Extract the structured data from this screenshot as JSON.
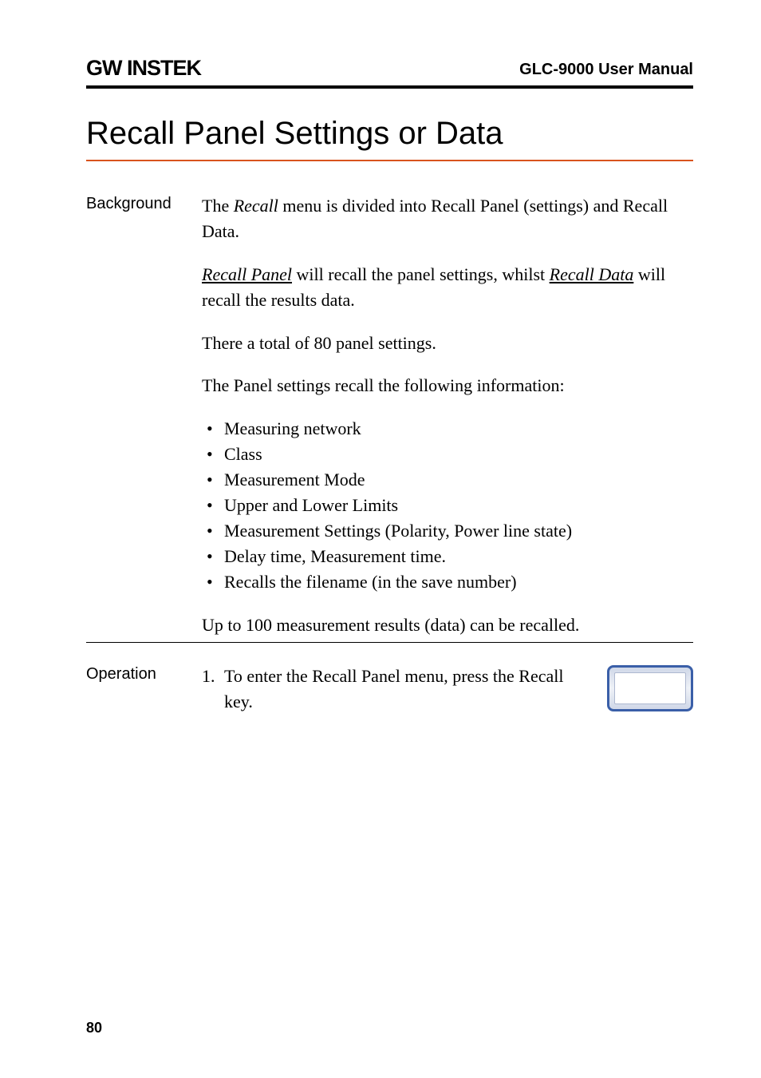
{
  "header": {
    "logo": "GW INSTEK",
    "manual": "GLC-9000 User Manual"
  },
  "section_title": "Recall Panel Settings or Data",
  "background": {
    "label": "Background",
    "p1_prefix": "The ",
    "p1_recall": "Recall",
    "p1_suffix": " menu is divided into Recall Panel (settings) and Recall Data.",
    "p2_recall_panel": "Recall Panel",
    "p2_mid": " will recall the panel settings, whilst ",
    "p2_recall_data": "Recall Data",
    "p2_suffix": " will recall the results data.",
    "p3": " There a total of 80 panel settings.",
    "p4": "The Panel settings recall the following information:",
    "bullets": [
      "Measuring network",
      "Class",
      "Measurement Mode",
      "Upper and Lower Limits",
      "Measurement Settings (Polarity, Power line state)",
      "Delay time, Measurement time.",
      "Recalls the filename (in the save number)"
    ],
    "p5": "Up to 100 measurement results (data) can be recalled."
  },
  "operation": {
    "label": "Operation",
    "step_num": "1.",
    "step_prefix": "To enter the ",
    "step_recall_panel": "Recall Panel",
    "step_mid": " menu, press the ",
    "step_recall": "Recall",
    "step_suffix": " key."
  },
  "page_number": "80"
}
